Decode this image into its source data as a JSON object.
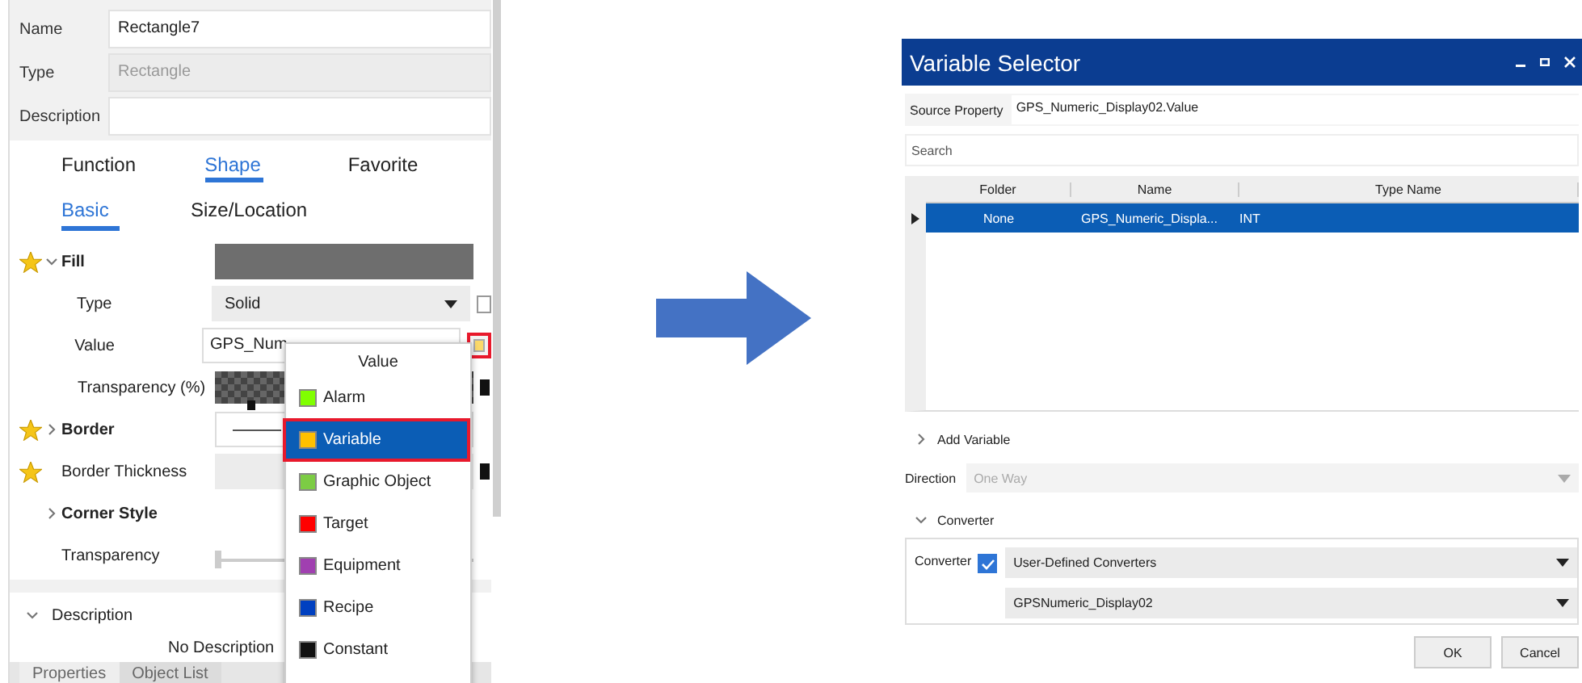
{
  "properties_panel": {
    "fields": [
      {
        "label": "Name",
        "value": "Rectangle7",
        "disabled": false
      },
      {
        "label": "Type",
        "value": "Rectangle",
        "disabled": true
      },
      {
        "label": "Description",
        "disabled": false
      }
    ],
    "tabs": [
      {
        "label": "Function",
        "selected": false
      },
      {
        "label": "Shape",
        "selected": true
      },
      {
        "label": "Favorite",
        "selected": false
      }
    ],
    "subtabs": [
      {
        "label": "Basic",
        "selected": true
      },
      {
        "label": "Size/Location",
        "selected": false
      }
    ],
    "properties": [
      {
        "kind": "swatch",
        "label": "Fill",
        "starred": true,
        "expanded": true,
        "children": [
          {
            "kind": "dropdown",
            "label": "Type",
            "value": "Solid",
            "checked": false
          },
          {
            "kind": "field",
            "label": "Value",
            "value": "GPS_Num",
            "highlighted": true
          },
          {
            "kind": "checker",
            "label": "Transparency (%)",
            "marker": true
          }
        ]
      },
      {
        "kind": "line",
        "label": "Border",
        "starred": true,
        "expanded": false,
        "marker": false
      },
      {
        "kind": "plain",
        "label": "Border Thickness",
        "starred": true,
        "marker": true
      },
      {
        "kind": "group",
        "label": "Corner Style",
        "starred": false,
        "expanded": false
      },
      {
        "kind": "slider",
        "label": "Transparency",
        "starred": false,
        "level": 0
      }
    ],
    "description": {
      "label": "Description",
      "expanded": true,
      "text": "No Description"
    },
    "bottom_tabs": [
      {
        "label": "Properties",
        "selected": true
      },
      {
        "label": "Object List",
        "selected": false
      }
    ]
  },
  "value_menu": {
    "title": "Value",
    "items": [
      {
        "label": "Alarm",
        "color": "#80ff00",
        "selected": false,
        "outlined": false
      },
      {
        "label": "Variable",
        "color": "#ffc000",
        "selected": true,
        "outlined": true
      },
      {
        "label": "Graphic Object",
        "color": "#7ccc44",
        "selected": false,
        "outlined": false
      },
      {
        "label": "Target",
        "color": "#ff0000",
        "selected": false,
        "outlined": false
      },
      {
        "label": "Equipment",
        "color": "#a040b0",
        "selected": false,
        "outlined": false
      },
      {
        "label": "Recipe",
        "color": "#0040c0",
        "selected": false,
        "outlined": false
      },
      {
        "label": "Constant",
        "color": "#111111",
        "selected": false,
        "outlined": false
      }
    ]
  },
  "dialog": {
    "title": "Variable Selector",
    "source_property": {
      "label": "Source Property",
      "value": "GPS_Numeric_Display02.Value"
    },
    "search": {
      "placeholder": "Search"
    },
    "table": {
      "columns": [
        "Folder",
        "Name",
        "Type Name"
      ],
      "rows": [
        {
          "cells": [
            "None",
            "GPS_Numeric_Displa...",
            "INT"
          ],
          "selected": true
        }
      ]
    },
    "add_variable": {
      "label": "Add Variable",
      "expanded": false
    },
    "direction": {
      "label": "Direction",
      "value": "One Way",
      "disabled": true
    },
    "converter_section": {
      "label": "Converter",
      "expanded": true
    },
    "converter": {
      "label": "Converter",
      "checked": true,
      "dropdowns": [
        "User-Defined Converters",
        "GPSNumeric_Display02"
      ]
    },
    "buttons": [
      "OK",
      "Cancel"
    ]
  }
}
